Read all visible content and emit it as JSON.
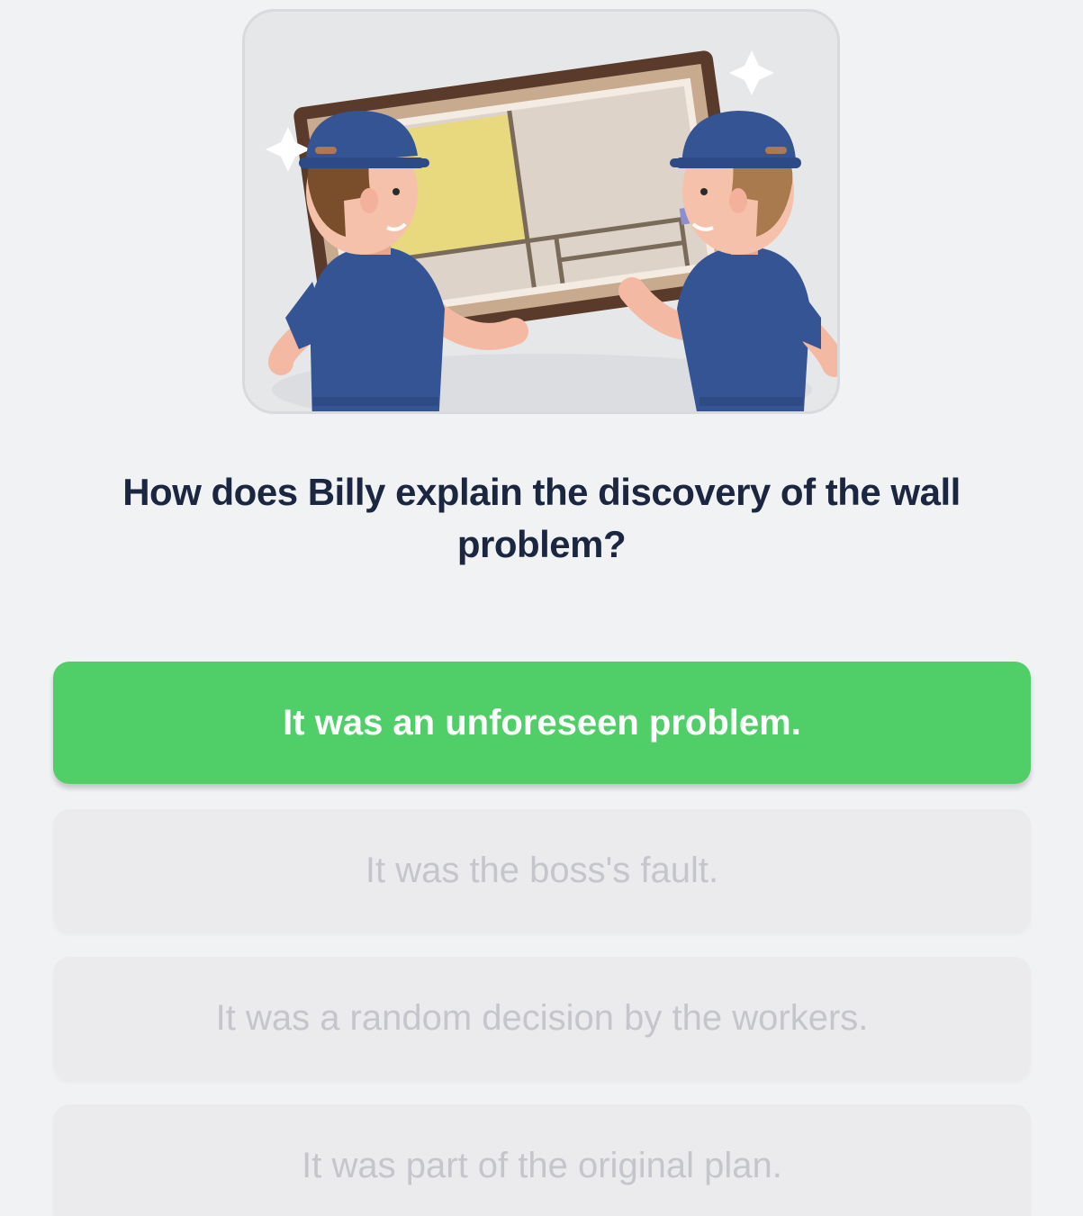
{
  "illustration": {
    "icon": "workers-hanging-map-illustration"
  },
  "question": {
    "text": "How does Billy explain the discovery of the wall problem?"
  },
  "answers": [
    {
      "label": "It was an unforeseen problem.",
      "state": "selected-correct"
    },
    {
      "label": "It was the boss's fault.",
      "state": "disabled"
    },
    {
      "label": "It was a random decision by the workers.",
      "state": "disabled"
    },
    {
      "label": "It was part of the original plan.",
      "state": "disabled"
    }
  ],
  "colors": {
    "correct": "#50ce68",
    "question_text": "#1b2640",
    "disabled_text": "#c4c6cc",
    "background": "#f1f2f4"
  }
}
